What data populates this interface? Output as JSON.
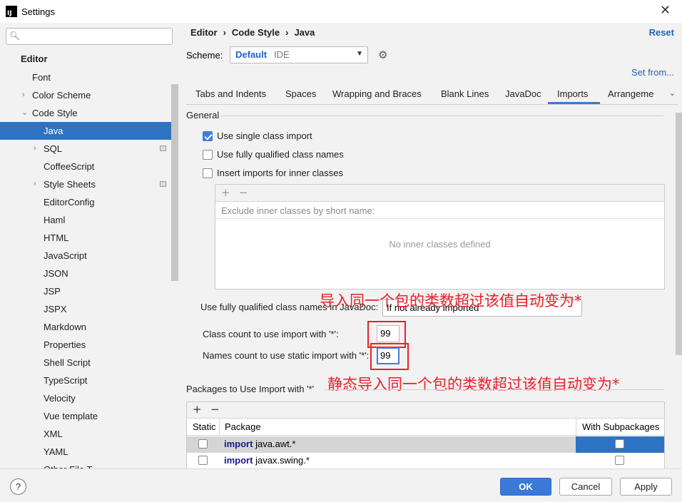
{
  "window": {
    "title": "Settings",
    "app_icon_label": "IJ"
  },
  "sidebar": {
    "search": {
      "placeholder": ""
    },
    "items": [
      {
        "label": "Editor"
      },
      {
        "label": "Font"
      },
      {
        "label": "Color Scheme"
      },
      {
        "label": "Code Style"
      },
      {
        "label": "Java"
      },
      {
        "label": "SQL"
      },
      {
        "label": "CoffeeScript"
      },
      {
        "label": "Style Sheets"
      },
      {
        "label": "EditorConfig"
      },
      {
        "label": "Haml"
      },
      {
        "label": "HTML"
      },
      {
        "label": "JavaScript"
      },
      {
        "label": "JSON"
      },
      {
        "label": "JSP"
      },
      {
        "label": "JSPX"
      },
      {
        "label": "Markdown"
      },
      {
        "label": "Properties"
      },
      {
        "label": "Shell Script"
      },
      {
        "label": "TypeScript"
      },
      {
        "label": "Velocity"
      },
      {
        "label": "Vue template"
      },
      {
        "label": "XML"
      },
      {
        "label": "YAML"
      },
      {
        "label": "Other File T..."
      }
    ]
  },
  "header": {
    "breadcrumb": [
      "Editor",
      "Code Style",
      "Java"
    ],
    "breadcrumb_sep": "›",
    "reset_label": "Reset",
    "scheme_label": "Scheme:",
    "scheme_value": "Default",
    "scheme_suffix": "IDE",
    "set_from_label": "Set from..."
  },
  "tabs": [
    {
      "label": "Tabs and Indents"
    },
    {
      "label": "Spaces"
    },
    {
      "label": "Wrapping and Braces"
    },
    {
      "label": "Blank Lines"
    },
    {
      "label": "JavaDoc"
    },
    {
      "label": "Imports"
    },
    {
      "label": "Arrangeme"
    }
  ],
  "general": {
    "title": "General",
    "options": [
      {
        "label": "Use single class import",
        "checked": true
      },
      {
        "label": "Use fully qualified class names",
        "checked": false
      },
      {
        "label": "Insert imports for inner classes",
        "checked": false
      }
    ],
    "inner_list": {
      "plus": "+",
      "minus": "−",
      "header": "Exclude inner classes by short name:",
      "empty_text": "No inner classes defined"
    },
    "javadoc_label": "Use fully qualified class names in JavaDoc:",
    "javadoc_value": "If not already imported",
    "class_count_label": "Class count to use import with '*':",
    "class_count_value": "99",
    "names_count_label": "Names count to use static import with '*':",
    "names_count_value": "99"
  },
  "annotations": {
    "class_count_note": "导入同一个包的类数超过该值自动变为*",
    "names_count_note": "静态导入同一个包的类数超过该值自动变为*",
    "color": "#e8212a"
  },
  "packages": {
    "title": "Packages to Use Import with '*'",
    "plus": "+",
    "minus": "−",
    "columns": [
      "Static",
      "Package",
      "With Subpackages"
    ],
    "rows": [
      {
        "keyword": "import",
        "name": "java.awt.*",
        "static": false,
        "subpackages": false,
        "selected": true
      },
      {
        "keyword": "import",
        "name": "javax.swing.*",
        "static": false,
        "subpackages": false,
        "selected": false
      }
    ]
  },
  "footer": {
    "help": "?",
    "ok": "OK",
    "cancel": "Cancel",
    "apply": "Apply"
  },
  "colors": {
    "accent": "#2d73c1",
    "link": "#2464b4",
    "selected_row": "#d5d5d5"
  }
}
